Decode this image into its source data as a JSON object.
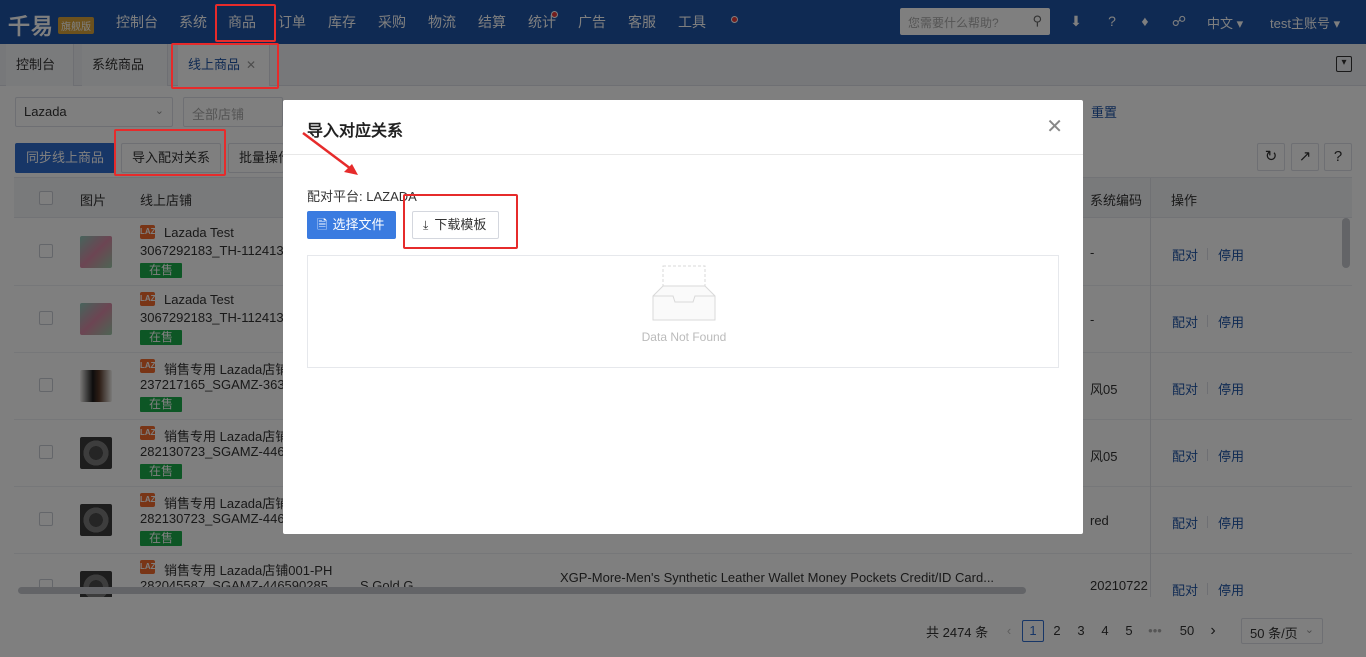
{
  "app": {
    "logo": "千易",
    "edition_badge": "旗舰版"
  },
  "nav": {
    "items": [
      "控制台",
      "系统",
      "商品",
      "订单",
      "库存",
      "采购",
      "物流",
      "结算",
      "统计",
      "广告",
      "客服",
      "工具"
    ],
    "help_placeholder": "您需要什么帮助?",
    "language": "中文",
    "account": "test主账号"
  },
  "tabs": [
    {
      "label": "控制台"
    },
    {
      "label": "系统商品"
    },
    {
      "label": "线上商品"
    }
  ],
  "filters": {
    "platform": "Lazada",
    "shop_placeholder": "全部店铺",
    "reset": "重置"
  },
  "toolbar": {
    "sync": "同步线上商品",
    "import_mapping": "导入配对关系",
    "batch": "批量操作"
  },
  "table": {
    "headers": {
      "image": "图片",
      "shop": "线上店铺",
      "syscode": "系统编码",
      "ops": "操作"
    },
    "op_match": "配对",
    "op_disable": "停用",
    "rows": [
      {
        "shop": "Lazada Test",
        "id": "3067292183_TH-112413",
        "status": "在售",
        "syscode": "-"
      },
      {
        "shop": "Lazada Test",
        "id": "3067292183_TH-112413",
        "status": "在售",
        "syscode": "-"
      },
      {
        "shop": "销售专用 Lazada店铺",
        "id": "237217165_SGAMZ-363",
        "status": "在售",
        "syscode": "风05"
      },
      {
        "shop": "销售专用 Lazada店铺",
        "id": "282130723_SGAMZ-446",
        "status": "在售",
        "syscode": "风05"
      },
      {
        "shop": "销售专用 Lazada店铺",
        "id": "282130723_SGAMZ-446",
        "status": "在售",
        "syscode": "red"
      },
      {
        "shop": "销售专用 Lazada店铺001-PH",
        "id": "282045587_SGAMZ-446590285",
        "status": "",
        "syscode": "20210722",
        "extra_col": "S Gold G",
        "title": "XGP-More-Men's Synthetic Leather Wallet Money Pockets Credit/ID Card..."
      }
    ],
    "shop_badge": "LAZ"
  },
  "pagination": {
    "total": "共 2474 条",
    "pages": [
      "1",
      "2",
      "3",
      "4",
      "5",
      "•••",
      "50"
    ],
    "current": "1",
    "page_size": "50 条/页"
  },
  "modal": {
    "title": "导入对应关系",
    "platform_label": "配对平台: LAZADA",
    "choose_file": "选择文件",
    "download_template": "下载模板",
    "empty_text": "Data Not Found"
  },
  "colors": {
    "nav_bg": "#1f55a6",
    "primary": "#2f6ccf",
    "status_green": "#1aad4a",
    "highlight": "#e62b2b"
  }
}
